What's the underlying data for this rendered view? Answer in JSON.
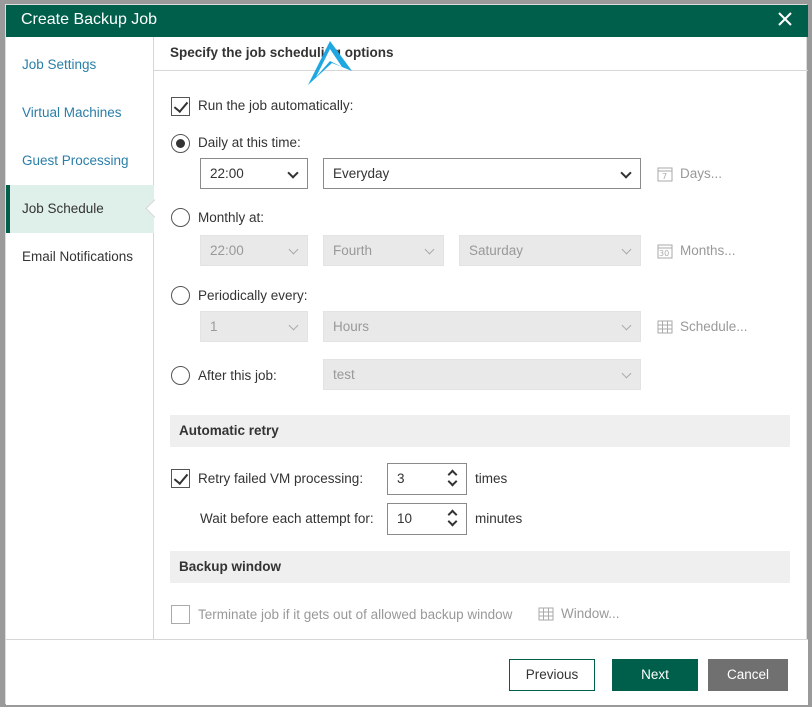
{
  "dialog": {
    "title": "Create Backup Job"
  },
  "sidebar": {
    "items": [
      {
        "label": "Job Settings"
      },
      {
        "label": "Virtual Machines"
      },
      {
        "label": "Guest Processing"
      },
      {
        "label": "Job Schedule",
        "active": true
      },
      {
        "label": "Email Notifications"
      }
    ]
  },
  "main": {
    "section_title": "Specify the job scheduling options",
    "run_auto": {
      "label": "Run the job automatically:",
      "checked": true
    },
    "daily": {
      "label": "Daily at this time:",
      "selected": true,
      "time": "22:00",
      "frequency": "Everyday",
      "days_button": "Days..."
    },
    "monthly": {
      "label": "Monthly at:",
      "selected": false,
      "time": "22:00",
      "week": "Fourth",
      "day": "Saturday",
      "months_button": "Months..."
    },
    "periodic": {
      "label": "Periodically every:",
      "selected": false,
      "count": "1",
      "unit": "Hours",
      "schedule_button": "Schedule..."
    },
    "after_job": {
      "label": "After this job:",
      "selected": false,
      "job": "test"
    },
    "retry": {
      "header": "Automatic retry",
      "retry_label": "Retry failed VM processing:",
      "retry_checked": true,
      "retry_value": "3",
      "retry_unit": "times",
      "wait_label": "Wait before each attempt for:",
      "wait_value": "10",
      "wait_unit": "minutes"
    },
    "backup_window": {
      "header": "Backup window",
      "terminate_label": "Terminate job if it gets out of allowed backup window",
      "terminate_checked": false,
      "window_button": "Window..."
    }
  },
  "footer": {
    "previous": "Previous",
    "next": "Next",
    "cancel": "Cancel"
  },
  "colors": {
    "brand": "#005f4b",
    "nav_active_bg": "#dff0ea",
    "link": "#2a7ea8",
    "cursor": "#1ea7e1"
  }
}
